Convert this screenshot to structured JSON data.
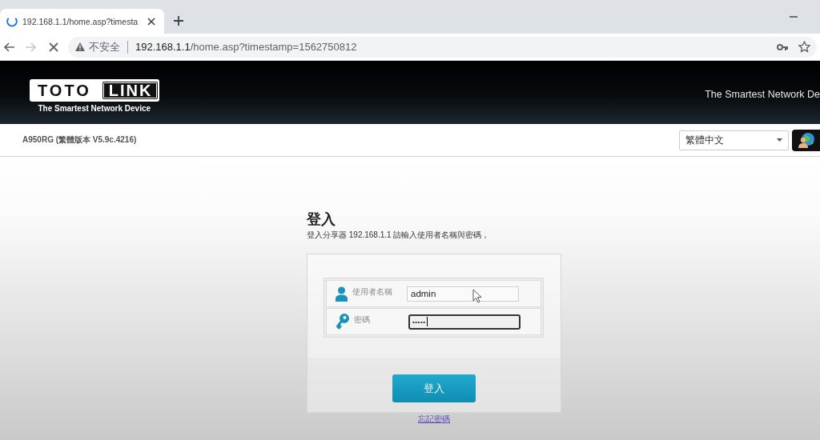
{
  "browser": {
    "tabs": [
      {
        "title": "192.168.1.1/home.asp?timesta",
        "selected": true,
        "loading": true
      }
    ],
    "navigation": {
      "forward_disabled": true
    },
    "address_bar": {
      "security_label": "不安全",
      "url_host": "192.168.1.1",
      "url_path": "/home.asp?timestamp=1562750812"
    }
  },
  "header": {
    "logo": {
      "word_1": "TOTO",
      "word_2": "LINK",
      "tagline": "The Smartest Network Device"
    },
    "slogan": "The Smartest Network De"
  },
  "info_bar": {
    "model": "A950RG (繁體版本 V5.9c.4216)",
    "language": "繁體中文"
  },
  "login": {
    "title": "登入",
    "instructions": "登入分享器 192.168.1.1 請輸入使用者名稱與密碼，",
    "fields": [
      {
        "kind": "username",
        "label": "使用者名稱",
        "value": "admin",
        "focused": false
      },
      {
        "kind": "password",
        "label": "密碼",
        "value": "•••••",
        "focused": true
      }
    ],
    "submit_button": "登入",
    "forgot_link": "忘記密碼"
  }
}
